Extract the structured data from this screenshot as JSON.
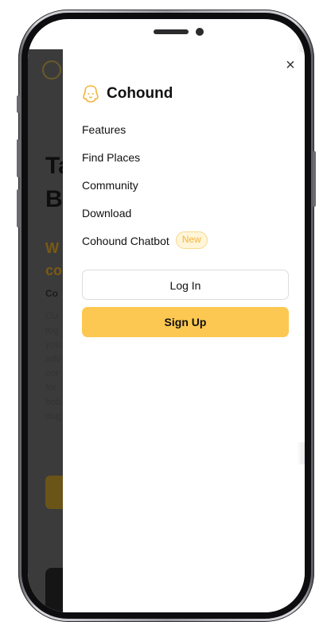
{
  "drawer": {
    "close_icon": "×",
    "brand": {
      "name": "Cohound",
      "icon": "dog-head-icon"
    },
    "nav": [
      {
        "label": "Features"
      },
      {
        "label": "Find Places"
      },
      {
        "label": "Community"
      },
      {
        "label": "Download"
      },
      {
        "label": "Cohound Chatbot",
        "badge": "New"
      }
    ],
    "login_label": "Log In",
    "signup_label": "Sign Up"
  },
  "background_page": {
    "title_fragments": [
      "Ta",
      "Bu"
    ],
    "orange_fragments": [
      "W",
      "co"
    ],
    "small_fragment": "Co",
    "text_fragments": [
      "Ou",
      "tog",
      "you",
      "adv",
      "cor",
      "for",
      "hob",
      "dog"
    ]
  },
  "colors": {
    "accent": "#fcc851",
    "badge_text": "#f3b53c",
    "badge_bg": "#fff5d9",
    "overlay": "#3b3b3b"
  }
}
